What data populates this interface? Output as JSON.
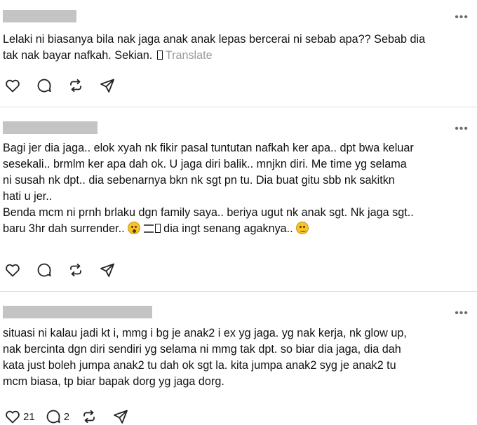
{
  "posts": [
    {
      "text_lines": [
        "Lelaki ni biasanya bila nak jaga anak anak lepas bercerai ni sebab apa?? Sebab dia",
        "tak nak bayar nafkah. Sekian."
      ],
      "translate_label": "Translate",
      "actions": {
        "like_count": "",
        "reply_count": ""
      }
    },
    {
      "text_lines": [
        "Bagi jer dia jaga.. elok xyah nk fikir pasal tuntutan nafkah ker apa.. dpt bwa keluar",
        "sesekali.. brmlm ker apa dah ok. U jaga diri balik.. mnjkn diri. Me time yg selama",
        "ni susah nk dpt.. dia sebenarnya bkn nk sgt pn tu. Dia buat gitu sbb nk sakitkn",
        "hati u jer..",
        "Benda mcm ni prnh brlaku dgn family saya.. beriya ugut nk anak sgt. Nk jaga sgt..",
        "baru 3hr dah surrender..",
        " dia ingt senang agaknya.."
      ],
      "actions": {
        "like_count": "",
        "reply_count": ""
      }
    },
    {
      "text_lines": [
        "situasi ni kalau jadi kt i, mmg i bg je anak2 i ex yg jaga. yg nak kerja, nk glow up,",
        "nak bercinta dgn diri sendiri yg selama ni mmg tak dpt. so biar dia jaga, dia dah",
        "kata just boleh jumpa anak2 tu dah ok sgt la. kita jumpa anak2 syg je anak2 tu",
        "mcm biasa, tp biar bapak dorg yg jaga dorg."
      ],
      "actions": {
        "like_count": "21",
        "reply_count": "2"
      }
    }
  ],
  "icons": {
    "like": "heart-icon",
    "reply": "comment-icon",
    "repost": "repost-icon",
    "share": "share-icon",
    "more": "more-options-icon"
  },
  "more_glyph": "•••"
}
